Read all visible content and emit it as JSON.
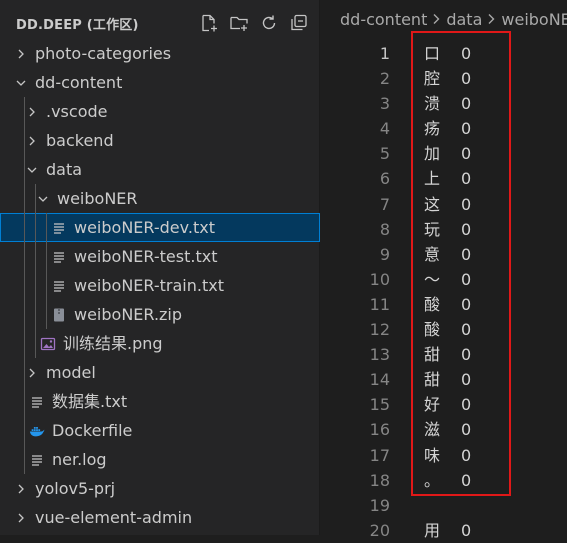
{
  "explorer": {
    "title": "DD.DEEP (工作区)",
    "toolbar": [
      {
        "name": "new-file-icon"
      },
      {
        "name": "new-folder-icon"
      },
      {
        "name": "refresh-icon"
      },
      {
        "name": "collapse-all-icon"
      }
    ],
    "tree": [
      {
        "label": "photo-categories",
        "depth": 0,
        "kind": "folder",
        "expanded": false
      },
      {
        "label": "dd-content",
        "depth": 0,
        "kind": "folder",
        "expanded": true
      },
      {
        "label": ".vscode",
        "depth": 1,
        "kind": "folder",
        "expanded": false
      },
      {
        "label": "backend",
        "depth": 1,
        "kind": "folder",
        "expanded": false
      },
      {
        "label": "data",
        "depth": 1,
        "kind": "folder",
        "expanded": true
      },
      {
        "label": "weiboNER",
        "depth": 2,
        "kind": "folder",
        "expanded": true
      },
      {
        "label": "weiboNER-dev.txt",
        "depth": 3,
        "kind": "text",
        "selected": true
      },
      {
        "label": "weiboNER-test.txt",
        "depth": 3,
        "kind": "text"
      },
      {
        "label": "weiboNER-train.txt",
        "depth": 3,
        "kind": "text"
      },
      {
        "label": "weiboNER.zip",
        "depth": 3,
        "kind": "zip"
      },
      {
        "label": "训练结果.png",
        "depth": 2,
        "kind": "image"
      },
      {
        "label": "model",
        "depth": 1,
        "kind": "folder",
        "expanded": false
      },
      {
        "label": "数据集.txt",
        "depth": 1,
        "kind": "text"
      },
      {
        "label": "Dockerfile",
        "depth": 1,
        "kind": "docker"
      },
      {
        "label": "ner.log",
        "depth": 1,
        "kind": "text"
      },
      {
        "label": "yolov5-prj",
        "depth": 0,
        "kind": "folder",
        "expanded": false
      },
      {
        "label": "vue-element-admin",
        "depth": 0,
        "kind": "folder",
        "expanded": false
      }
    ]
  },
  "editor": {
    "breadcrumb": [
      "dd-content",
      "data",
      "weiboNE"
    ],
    "active_line": 1,
    "lines": [
      {
        "n": "1",
        "char": "口",
        "tag": "0"
      },
      {
        "n": "2",
        "char": "腔",
        "tag": "0"
      },
      {
        "n": "3",
        "char": "溃",
        "tag": "0"
      },
      {
        "n": "4",
        "char": "疡",
        "tag": "0"
      },
      {
        "n": "5",
        "char": "加",
        "tag": "0"
      },
      {
        "n": "6",
        "char": "上",
        "tag": "0"
      },
      {
        "n": "7",
        "char": "这",
        "tag": "0"
      },
      {
        "n": "8",
        "char": "玩",
        "tag": "0"
      },
      {
        "n": "9",
        "char": "意",
        "tag": "0"
      },
      {
        "n": "10",
        "char": "～",
        "tag": "0"
      },
      {
        "n": "11",
        "char": "酸",
        "tag": "0"
      },
      {
        "n": "12",
        "char": "酸",
        "tag": "0"
      },
      {
        "n": "13",
        "char": "甜",
        "tag": "0"
      },
      {
        "n": "14",
        "char": "甜",
        "tag": "0"
      },
      {
        "n": "15",
        "char": "好",
        "tag": "0"
      },
      {
        "n": "16",
        "char": "滋",
        "tag": "0"
      },
      {
        "n": "17",
        "char": "味",
        "tag": "0"
      },
      {
        "n": "18",
        "char": "。",
        "tag": "0"
      },
      {
        "n": "19",
        "char": "",
        "tag": ""
      },
      {
        "n": "20",
        "char": "用",
        "tag": "0"
      }
    ]
  },
  "colors": {
    "sidebar_bg": "#252526",
    "editor_bg": "#1e1e1e",
    "selection_bg": "#04395e",
    "selection_border": "#007fd4",
    "highlight_box": "#e01818",
    "docker_blue": "#2496ed"
  }
}
